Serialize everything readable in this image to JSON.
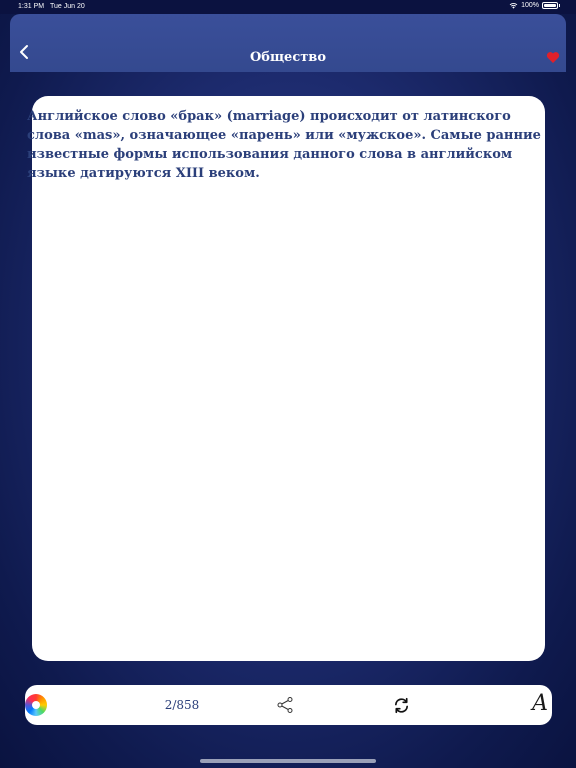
{
  "status_bar": {
    "time": "1:31 PM",
    "date": "Tue Jun 20",
    "battery": "100%"
  },
  "nav": {
    "title": "Общество",
    "icons": {
      "back": "chevron-left-icon",
      "favorite": "heart-icon"
    },
    "favorite_color": "#e0202a"
  },
  "content": {
    "fact": "Английское слово «брак» (marriage) происходит от латинского слова «mas», означающее «парень» или «мужское». Самые ранние известные формы использования данного слова в английском языке датируются XIII веком."
  },
  "toolbar": {
    "counter": "2/858",
    "font_label": "A",
    "icons": {
      "color": "color-wheel-icon",
      "share": "share-icon",
      "refresh": "refresh-icon"
    }
  },
  "colors": {
    "background": "#1d2b6e",
    "nav_bar": "#3a4f9a",
    "text": "#2b3f7a"
  }
}
